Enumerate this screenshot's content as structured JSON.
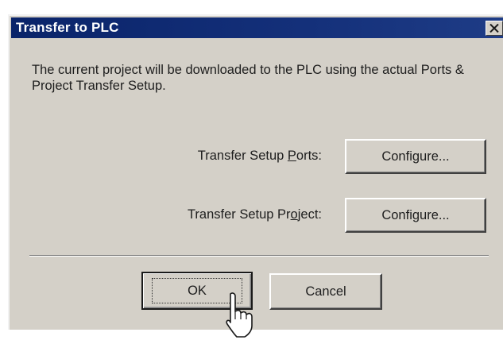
{
  "dialog": {
    "title": "Transfer to PLC",
    "close_glyph": "×",
    "message": "The current project will be downloaded to the PLC using the actual Ports & Project Transfer Setup.",
    "ports_label_before": "Transfer Setup ",
    "ports_label_accel": "P",
    "ports_label_after": "orts:",
    "project_label_before": "Transfer Setup Pr",
    "project_label_accel": "o",
    "project_label_after": "ject:",
    "configure_ports_label": "Configure...",
    "configure_project_label": "Configure...",
    "ok_label": "OK",
    "cancel_label": "Cancel"
  },
  "icons": {
    "close": "close-icon",
    "cursor": "hand-pointer-cursor-icon"
  },
  "colors": {
    "titlebar": "#0a246a",
    "dialog_face": "#d4d0c8",
    "title_text": "#ffffff"
  }
}
